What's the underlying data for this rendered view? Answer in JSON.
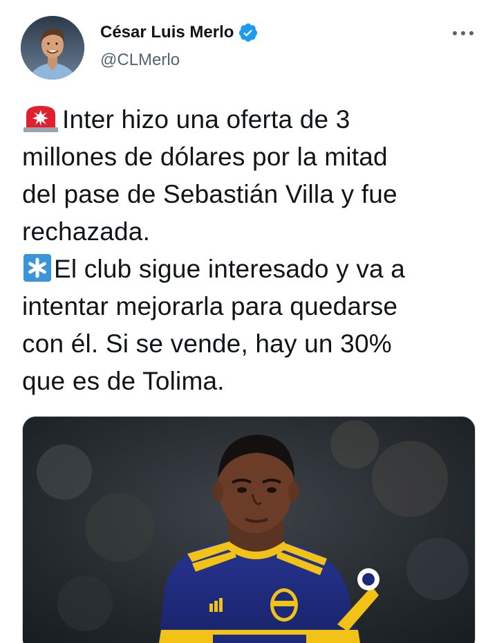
{
  "tweet": {
    "author": {
      "display_name": "César Luis Merlo",
      "handle": "@CLMerlo",
      "verified": true
    },
    "text_lines": [
      "Inter hizo una oferta de 3",
      "millones de dólares por la mitad",
      "del pase de Sebastián Villa y fue",
      "rechazada.",
      "El club sigue interesado y va a",
      "intentar mejorarla para quedarse",
      "con él. Si se vende, hay un 30%",
      "que es de Tolima."
    ],
    "emojis": [
      "police-light-emoji",
      "asterisk-emoji"
    ],
    "media_description_icon": "photo"
  },
  "colors": {
    "text_primary": "#0f1419",
    "text_secondary": "#536471",
    "verified_blue": "#1d9bf0",
    "jersey_blue": "#1d2a7a",
    "jersey_yellow": "#f2c216",
    "emoji_red": "#e0202f",
    "emoji_asterisk_bg": "#3b94d9"
  }
}
